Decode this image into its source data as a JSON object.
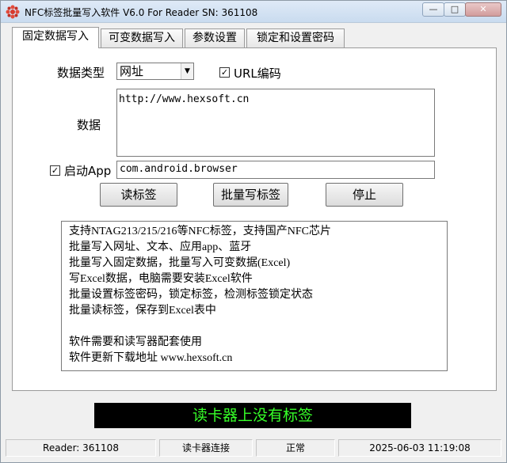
{
  "window": {
    "title": "NFC标签批量写入软件 V6.0 For Reader  SN:  361108",
    "min_symbol": "—",
    "max_symbol": "□",
    "close_symbol": "✕"
  },
  "tabs": [
    {
      "label": "固定数据写入",
      "active": true
    },
    {
      "label": "可变数据写入",
      "active": false
    },
    {
      "label": "参数设置",
      "active": false
    },
    {
      "label": "锁定和设置密码",
      "active": false
    }
  ],
  "form": {
    "data_type_label": "数据类型",
    "data_type_value": "网址",
    "url_encode_label": "URL编码",
    "url_encode_checked": true,
    "data_label": "数据",
    "data_value": "http://www.hexsoft.cn",
    "launch_app_label": "启动App",
    "launch_app_checked": true,
    "launch_app_value": "com.android.browser"
  },
  "buttons": {
    "read": "读标签",
    "batch_write": "批量写标签",
    "stop": "停止"
  },
  "info_lines": [
    "支持NTAG213/215/216等NFC标签，支持国产NFC芯片",
    "批量写入网址、文本、应用app、蓝牙",
    "批量写入固定数据，批量写入可变数据(Excel)",
    "写Excel数据，电脑需要安装Excel软件",
    "批量设置标签密码，锁定标签，检测标签锁定状态",
    "批量读标签，保存到Excel表中",
    "",
    "软件需要和读写器配套使用",
    "软件更新下载地址 www.hexsoft.cn"
  ],
  "status_display": "读卡器上没有标签",
  "statusbar": {
    "reader": "Reader: 361108",
    "connection": "读卡器连接",
    "state": "正常",
    "datetime": "2025-06-03 11:19:08"
  },
  "colors": {
    "status_text": "#36ff28",
    "status_bg": "#000000"
  }
}
